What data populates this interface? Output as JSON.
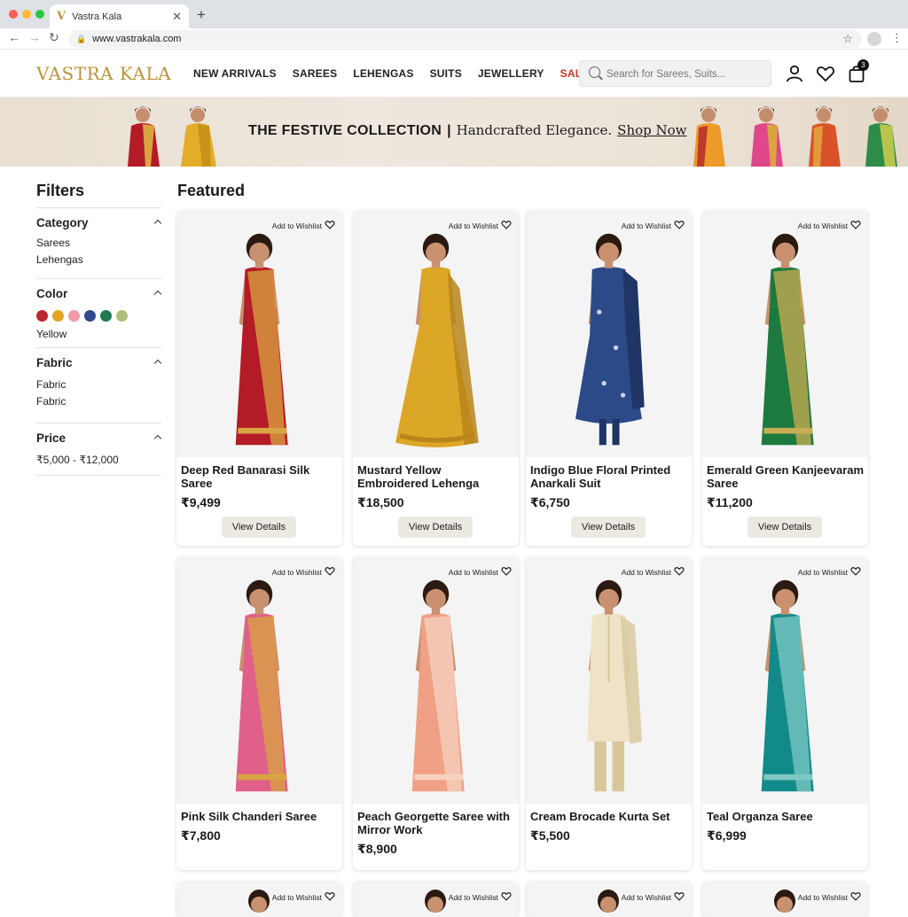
{
  "browser": {
    "tab_title": "Vastra Kala",
    "tab_favicon": "V",
    "url": "www.vastrakala.com"
  },
  "header": {
    "logo": "VASTRA KALA",
    "nav": [
      "NEW ARRIVALS",
      "SAREES",
      "LEHENGAS",
      "SUITS",
      "JEWELLERY",
      "SALE"
    ],
    "search_placeholder": "Search for Sarees, Suits...",
    "cart_count": "3",
    "accent_gold": "#b8943c",
    "sale_red": "#c0392b"
  },
  "banner": {
    "headline": "THE FESTIVE COLLECTION",
    "separator": "|",
    "tagline": "Handcrafted Elegance.",
    "cta": "Shop Now"
  },
  "filters": {
    "title": "Filters",
    "category": {
      "label": "Category",
      "options": [
        "Sarees",
        "Lehengas"
      ]
    },
    "color": {
      "label": "Color",
      "swatches": [
        "#b8282f",
        "#e0a422",
        "#f09aa6",
        "#2f4a8f",
        "#1f7a4f",
        "#aebd7a"
      ],
      "selected": "Yellow"
    },
    "fabric": {
      "label": "Fabric",
      "options": [
        "Fabric",
        "Fabric"
      ]
    },
    "price": {
      "label": "Price",
      "range": "₹5,000 - ₹12,000"
    }
  },
  "main": {
    "section_title": "Featured",
    "wishlist_label": "Add to Wishlist",
    "view_label": "View Details",
    "products": [
      {
        "name": "Deep Red Banarasi Silk Saree",
        "price": "₹9,499",
        "color": "#b31b26",
        "accent": "#d9a441",
        "style": "saree"
      },
      {
        "name": "Mustard Yellow Embroidered Lehenga",
        "price": "₹18,500",
        "color": "#dca627",
        "accent": "#b9851a",
        "style": "lehenga"
      },
      {
        "name": "Indigo Blue Floral Printed Anarkali Suit",
        "price": "₹6,750",
        "color": "#2c4a87",
        "accent": "#c9d3e8",
        "style": "anarkali"
      },
      {
        "name": "Emerald Green Kanjeevaram Saree",
        "price": "₹11,200",
        "color": "#1d7a3e",
        "accent": "#c9ad54",
        "style": "saree"
      },
      {
        "name": "Pink Silk Chanderi Saree",
        "price": "₹7,800",
        "color": "#e0608a",
        "accent": "#d9a441",
        "style": "saree"
      },
      {
        "name": "Peach Georgette Saree with Mirror Work",
        "price": "₹8,900",
        "color": "#f0a084",
        "accent": "#f6d1c0",
        "style": "saree"
      },
      {
        "name": "Cream Brocade Kurta Set",
        "price": "₹5,500",
        "color": "#eee3c6",
        "accent": "#d8c79b",
        "style": "kurta"
      },
      {
        "name": "Teal Organza Saree",
        "price": "₹6,999",
        "color": "#138a8a",
        "accent": "#7fc8c4",
        "style": "saree"
      }
    ]
  }
}
